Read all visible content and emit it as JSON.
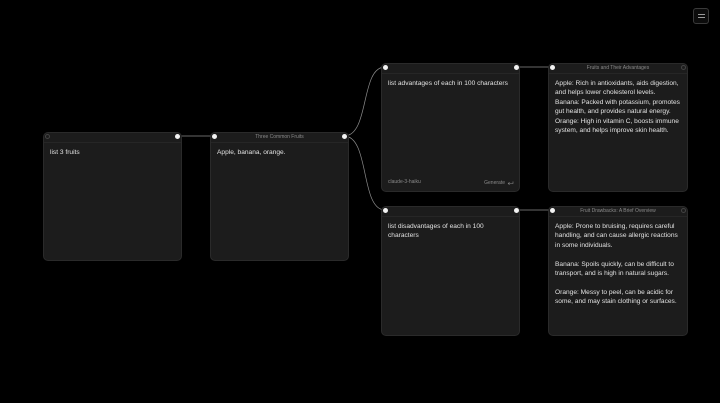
{
  "toolbar": {
    "menu_icon": "hamburger-icon"
  },
  "nodes": {
    "prompt1": {
      "header": "",
      "text": "list 3 fruits"
    },
    "response1": {
      "header": "Three Common Fruits",
      "text": "Apple, banana, orange."
    },
    "prompt2": {
      "header": "",
      "text": "list advantages of each in 100 characters",
      "model": "claude-3-haiku",
      "generate_label": "Generate",
      "generate_icon": "enter-icon"
    },
    "response2": {
      "header": "Fruits and Their Advantages",
      "text": "Apple: Rich in antioxidants, aids digestion, and helps lower cholesterol levels.\nBanana: Packed with potassium, promotes gut health, and provides natural energy.\nOrange: High in vitamin C, boosts immune system, and helps improve skin health."
    },
    "prompt3": {
      "header": "",
      "text": "list disadvantages of each in 100 characters"
    },
    "response3": {
      "header": "Fruit Drawbacks: A Brief Overview",
      "text": "Apple: Prone to bruising, requires careful handling, and can cause allergic reactions in some individuals.\n\nBanana: Spoils quickly, can be difficult to transport, and is high in natural sugars.\n\nOrange: Messy to peel, can be acidic for some, and may stain clothing or surfaces."
    }
  },
  "colors": {
    "background": "#000000",
    "node_fill": "#1c1c1c",
    "node_border": "#2a2a2a",
    "edge": "#8c8c8c",
    "port": "#f2f2f2"
  }
}
